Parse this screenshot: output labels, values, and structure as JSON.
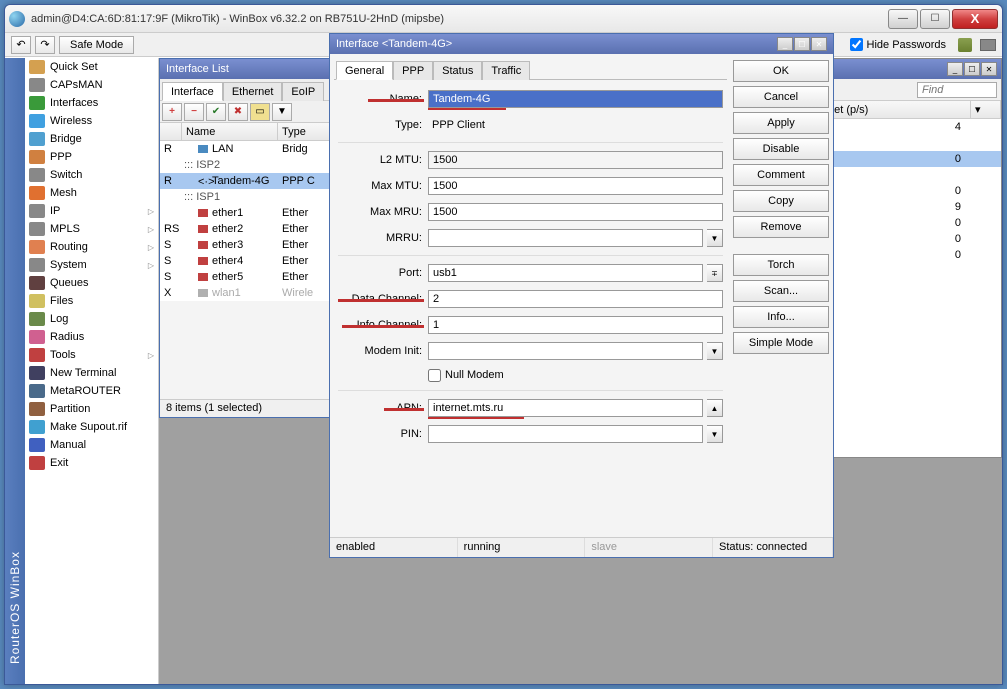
{
  "window": {
    "title": "admin@D4:CA:6D:81:17:9F (MikroTik) - WinBox v6.32.2 on RB751U-2HnD (mipsbe)"
  },
  "toolbar": {
    "back": "↶",
    "fwd": "↷",
    "safe_mode": "Safe Mode",
    "hide_passwords": "Hide Passwords"
  },
  "strip_label": "RouterOS WinBox",
  "sidebar": {
    "items": [
      {
        "label": "Quick Set"
      },
      {
        "label": "CAPsMAN"
      },
      {
        "label": "Interfaces"
      },
      {
        "label": "Wireless"
      },
      {
        "label": "Bridge"
      },
      {
        "label": "PPP"
      },
      {
        "label": "Switch"
      },
      {
        "label": "Mesh"
      },
      {
        "label": "IP",
        "sub": true
      },
      {
        "label": "MPLS",
        "sub": true
      },
      {
        "label": "Routing",
        "sub": true
      },
      {
        "label": "System",
        "sub": true
      },
      {
        "label": "Queues"
      },
      {
        "label": "Files"
      },
      {
        "label": "Log"
      },
      {
        "label": "Radius"
      },
      {
        "label": "Tools",
        "sub": true
      },
      {
        "label": "New Terminal"
      },
      {
        "label": "MetaROUTER"
      },
      {
        "label": "Partition"
      },
      {
        "label": "Make Supout.rif"
      },
      {
        "label": "Manual"
      },
      {
        "label": "Exit"
      }
    ]
  },
  "iflist": {
    "title": "Interface List",
    "tabs": [
      "Interface",
      "Ethernet",
      "EoIP"
    ],
    "cols": [
      "",
      "Name",
      "Type"
    ],
    "rows": [
      {
        "f": "R",
        "n": "LAN",
        "t": "Bridg",
        "ico": "br"
      },
      {
        "f": "",
        "n": "::: ISP2",
        "t": "",
        "grp": true
      },
      {
        "f": "R",
        "n": "Tandem-4G",
        "t": "PPP C",
        "ico": "ppp",
        "sel": true
      },
      {
        "f": "",
        "n": "::: ISP1",
        "t": "",
        "grp": true
      },
      {
        "f": "",
        "n": "ether1",
        "t": "Ether",
        "ico": "eth"
      },
      {
        "f": "RS",
        "n": "ether2",
        "t": "Ether",
        "ico": "eth"
      },
      {
        "f": "S",
        "n": "ether3",
        "t": "Ether",
        "ico": "eth"
      },
      {
        "f": "S",
        "n": "ether4",
        "t": "Ether",
        "ico": "eth"
      },
      {
        "f": "S",
        "n": "ether5",
        "t": "Ether",
        "ico": "eth"
      },
      {
        "f": "X",
        "n": "wlan1",
        "t": "Wirele",
        "ico": "wl",
        "dis": true
      }
    ],
    "status": "8 items (1 selected)"
  },
  "dialog": {
    "title": "Interface <Tandem-4G>",
    "tabs": [
      "General",
      "PPP",
      "Status",
      "Traffic"
    ],
    "buttons": [
      "OK",
      "Cancel",
      "Apply",
      "Disable",
      "Comment",
      "Copy",
      "Remove",
      "Torch",
      "Scan...",
      "Info...",
      "Simple Mode"
    ],
    "fields": {
      "name_label": "Name:",
      "name": "Tandem-4G",
      "type_label": "Type:",
      "type": "PPP Client",
      "l2mtu_label": "L2 MTU:",
      "l2mtu": "1500",
      "maxmtu_label": "Max MTU:",
      "maxmtu": "1500",
      "maxmru_label": "Max MRU:",
      "maxmru": "1500",
      "mrru_label": "MRRU:",
      "mrru": "",
      "port_label": "Port:",
      "port": "usb1",
      "datach_label": "Data Channel:",
      "datach": "2",
      "infoch_label": "Info Channel:",
      "infoch": "1",
      "modeminit_label": "Modem Init:",
      "modeminit": "",
      "nullmodem_label": "Null Modem",
      "apn_label": "APN:",
      "apn": "internet.mts.ru",
      "pin_label": "PIN:",
      "pin": ""
    },
    "status": {
      "s1": "enabled",
      "s2": "running",
      "s3": "slave",
      "s4": "Status: connected"
    }
  },
  "right": {
    "find": "Find",
    "col": "acket (p/s)",
    "vals": [
      "4",
      "",
      "0",
      "",
      "0",
      "9",
      "0",
      "0",
      "0",
      ""
    ]
  }
}
